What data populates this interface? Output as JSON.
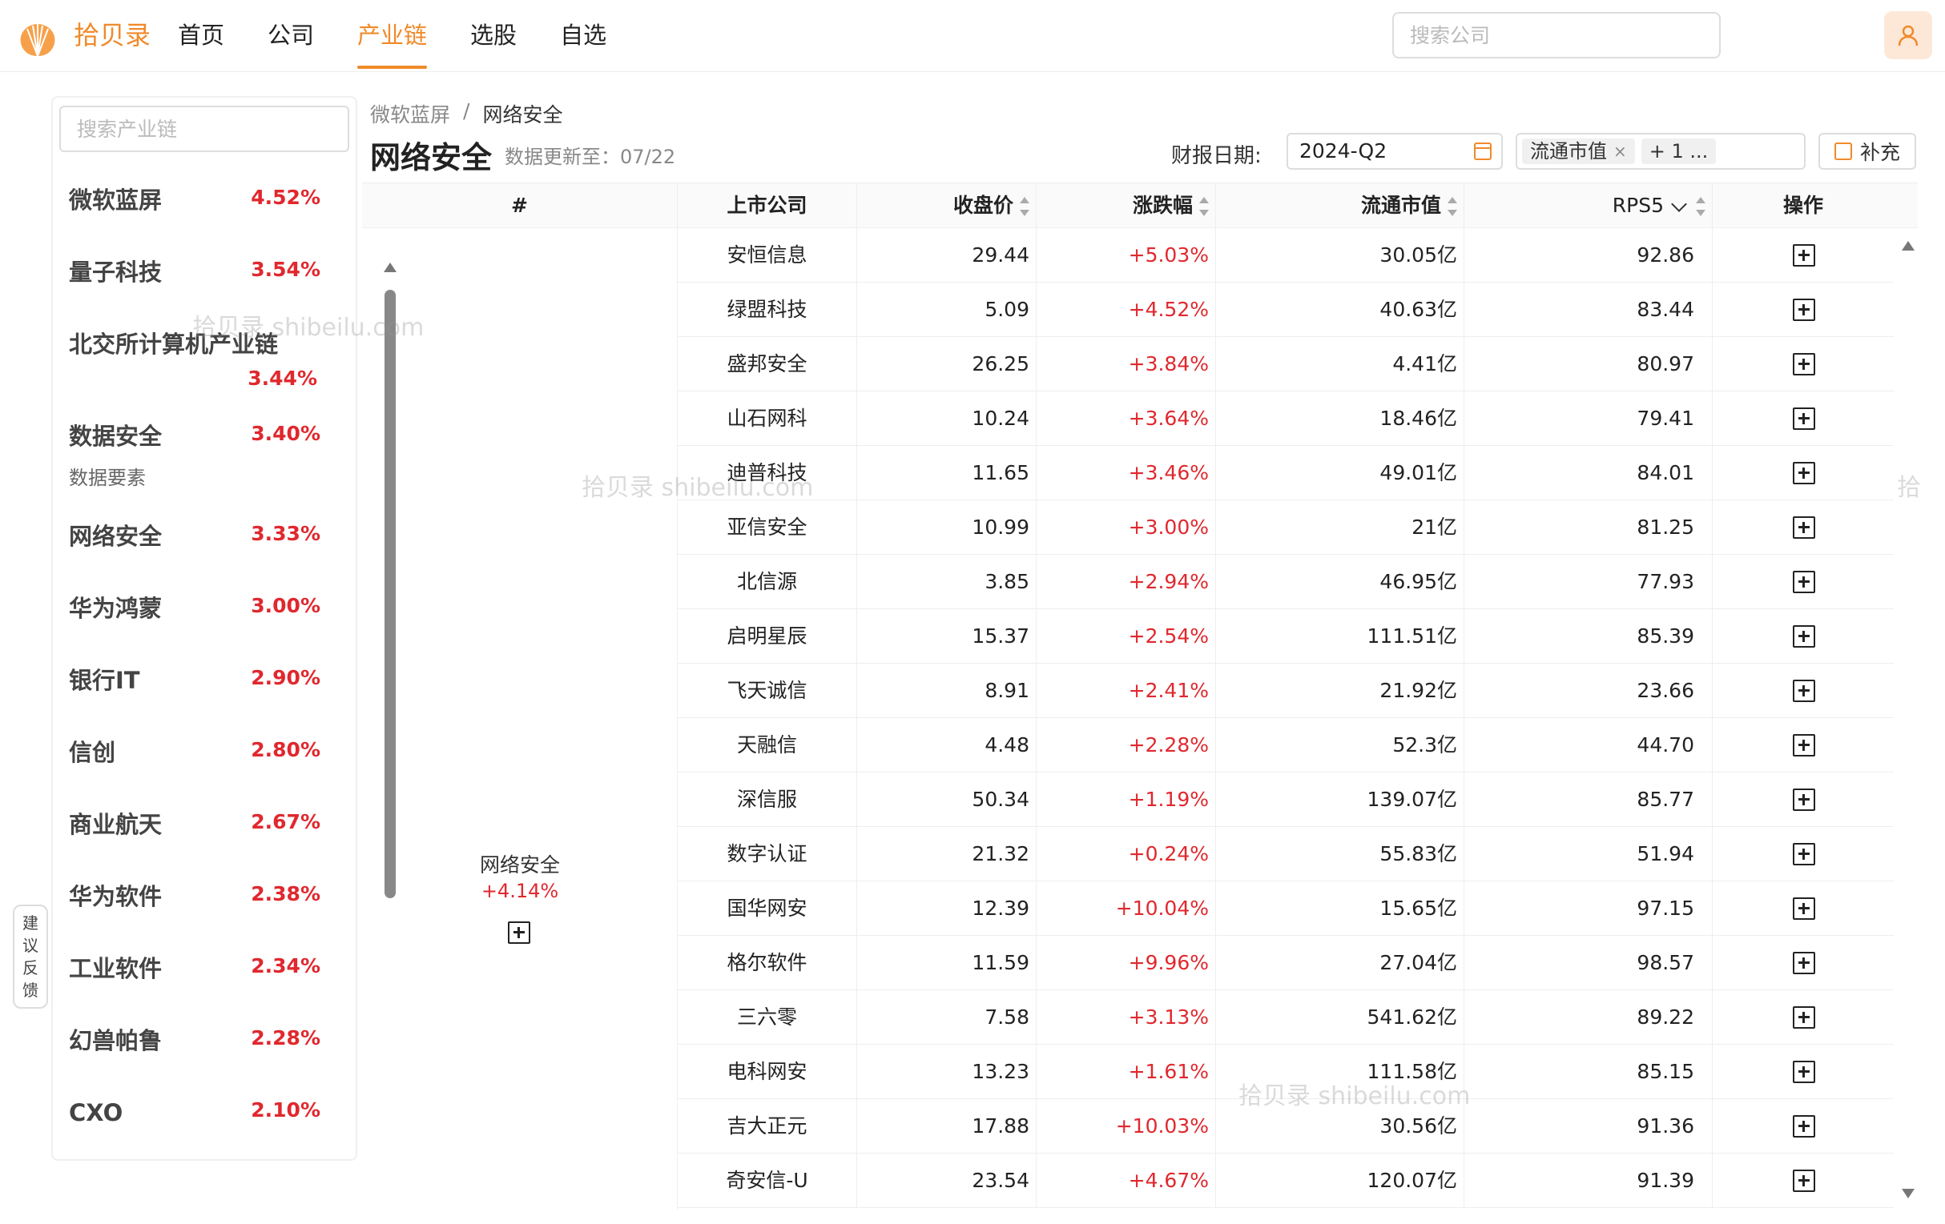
{
  "header": {
    "brand": "拾贝录",
    "nav": [
      "首页",
      "公司",
      "产业链",
      "选股",
      "自选"
    ],
    "active_nav": "产业链",
    "search_placeholder": "搜索公司"
  },
  "sidebar": {
    "search_placeholder": "搜索产业链",
    "items": [
      {
        "name": "微软蓝屏",
        "pct": "4.52%"
      },
      {
        "name": "量子科技",
        "pct": "3.54%"
      },
      {
        "name": "北交所计算机产业链",
        "pct": "3.44%"
      },
      {
        "name": "数据安全",
        "pct": "3.40%",
        "sub": "数据要素"
      },
      {
        "name": "网络安全",
        "pct": "3.33%"
      },
      {
        "name": "华为鸿蒙",
        "pct": "3.00%"
      },
      {
        "name": "银行IT",
        "pct": "2.90%"
      },
      {
        "name": "信创",
        "pct": "2.80%"
      },
      {
        "name": "商业航天",
        "pct": "2.67%"
      },
      {
        "name": "华为软件",
        "pct": "2.38%"
      },
      {
        "name": "工业软件",
        "pct": "2.34%"
      },
      {
        "name": "幻兽帕鲁",
        "pct": "2.28%"
      },
      {
        "name": "CXO",
        "pct": "2.10%"
      }
    ]
  },
  "feedback": [
    "建",
    "议",
    "反",
    "馈"
  ],
  "breadcrumb": {
    "parent": "微软蓝屏",
    "sep": "/",
    "current": "网络安全"
  },
  "page": {
    "title": "网络安全",
    "update": "数据更新至：07/22",
    "report_label": "财报日期:",
    "report_date": "2024-Q2",
    "tag1": "流通市值",
    "tag1_close": "×",
    "tag2": "+ 1 ...",
    "supplement": "补充"
  },
  "table": {
    "headers": {
      "idx": "#",
      "company": "上市公司",
      "close": "收盘价",
      "change": "涨跌幅",
      "cap": "流通市值",
      "rps": "RPS5",
      "op": "操作"
    },
    "group": {
      "name": "网络安全",
      "pct": "+4.14%"
    },
    "rows": [
      {
        "name": "安恒信息",
        "close": "29.44",
        "chg": "+5.03%",
        "cap": "30.05亿",
        "rps": "92.86"
      },
      {
        "name": "绿盟科技",
        "close": "5.09",
        "chg": "+4.52%",
        "cap": "40.63亿",
        "rps": "83.44"
      },
      {
        "name": "盛邦安全",
        "close": "26.25",
        "chg": "+3.84%",
        "cap": "4.41亿",
        "rps": "80.97"
      },
      {
        "name": "山石网科",
        "close": "10.24",
        "chg": "+3.64%",
        "cap": "18.46亿",
        "rps": "79.41"
      },
      {
        "name": "迪普科技",
        "close": "11.65",
        "chg": "+3.46%",
        "cap": "49.01亿",
        "rps": "84.01"
      },
      {
        "name": "亚信安全",
        "close": "10.99",
        "chg": "+3.00%",
        "cap": "21亿",
        "rps": "81.25"
      },
      {
        "name": "北信源",
        "close": "3.85",
        "chg": "+2.94%",
        "cap": "46.95亿",
        "rps": "77.93"
      },
      {
        "name": "启明星辰",
        "close": "15.37",
        "chg": "+2.54%",
        "cap": "111.51亿",
        "rps": "85.39"
      },
      {
        "name": "飞天诚信",
        "close": "8.91",
        "chg": "+2.41%",
        "cap": "21.92亿",
        "rps": "23.66"
      },
      {
        "name": "天融信",
        "close": "4.48",
        "chg": "+2.28%",
        "cap": "52.3亿",
        "rps": "44.70"
      },
      {
        "name": "深信服",
        "close": "50.34",
        "chg": "+1.19%",
        "cap": "139.07亿",
        "rps": "85.77"
      },
      {
        "name": "数字认证",
        "close": "21.32",
        "chg": "+0.24%",
        "cap": "55.83亿",
        "rps": "51.94"
      },
      {
        "name": "国华网安",
        "close": "12.39",
        "chg": "+10.04%",
        "cap": "15.65亿",
        "rps": "97.15"
      },
      {
        "name": "格尔软件",
        "close": "11.59",
        "chg": "+9.96%",
        "cap": "27.04亿",
        "rps": "98.57"
      },
      {
        "name": "三六零",
        "close": "7.58",
        "chg": "+3.13%",
        "cap": "541.62亿",
        "rps": "89.22"
      },
      {
        "name": "电科网安",
        "close": "13.23",
        "chg": "+1.61%",
        "cap": "111.58亿",
        "rps": "85.15"
      },
      {
        "name": "吉大正元",
        "close": "17.88",
        "chg": "+10.03%",
        "cap": "30.56亿",
        "rps": "91.36"
      },
      {
        "name": "奇安信-U",
        "close": "23.54",
        "chg": "+4.67%",
        "cap": "120.07亿",
        "rps": "91.39"
      }
    ]
  },
  "watermarks": [
    "拾贝录 shibeilu.com",
    "拾贝录 shibeilu.com",
    "拾贝录 shibeilu.com",
    "拾"
  ],
  "colors": {
    "accent": "#f08a2a",
    "up": "#e0282e"
  }
}
